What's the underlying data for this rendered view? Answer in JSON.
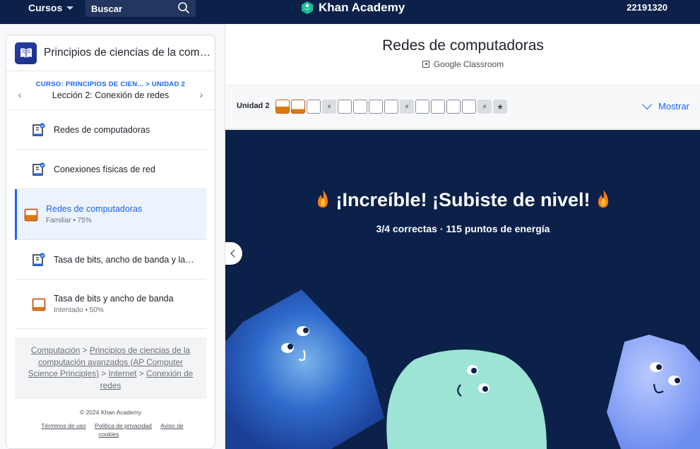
{
  "nav": {
    "courses_label": "Cursos",
    "search_placeholder": "Buscar",
    "logo_text": "Khan Academy",
    "user_id": "22191320"
  },
  "sidebar": {
    "course_title": "Principios de ciencias de la computación avanzados (AP Computer Science Principles)",
    "crumb": "CURSO: PRINCIPIOS DE CIEN... > UNIDAD 2",
    "lesson": "Lección 2: Conexión de redes",
    "items": [
      {
        "title": "Redes de computadoras",
        "sub": ""
      },
      {
        "title": "Conexiones físicas de red",
        "sub": ""
      },
      {
        "title": "Redes de computadoras",
        "sub": "Familiar • 75%"
      },
      {
        "title": "Tasa de bits, ancho de banda y latencia",
        "sub": ""
      },
      {
        "title": "Tasa de bits y ancho de banda",
        "sub": "Intentado • 50%"
      }
    ],
    "breadcrumbs": {
      "c1": "Computación",
      "c2": "Principios de ciencias de la computación avanzados (AP Computer Science Principles)",
      "c3": "Internet",
      "c4": "Conexión de redes",
      "sep": ">"
    },
    "footer": {
      "copyright": "© 2024 Khan Academy",
      "terms": "Términos de uso",
      "privacy": "Política de privacidad",
      "cookies": "Aviso de cookies"
    }
  },
  "main": {
    "title": "Redes de computadoras",
    "google_classroom": "Google Classroom",
    "unit_label": "Unidad 2",
    "show_label": "Mostrar",
    "skills": [
      "familiar",
      "attempted",
      "empty",
      "quiz",
      "empty",
      "empty",
      "empty",
      "empty",
      "quiz",
      "empty",
      "empty",
      "empty",
      "empty",
      "quiz",
      "test"
    ],
    "hero_title": "¡Increíble! ¡Subiste de nivel!",
    "hero_sub": "3/4 correctas · 115 puntos de energía"
  },
  "colors": {
    "navy": "#0b2149",
    "blue": "#1865f2",
    "orange": "#d97a0c"
  }
}
